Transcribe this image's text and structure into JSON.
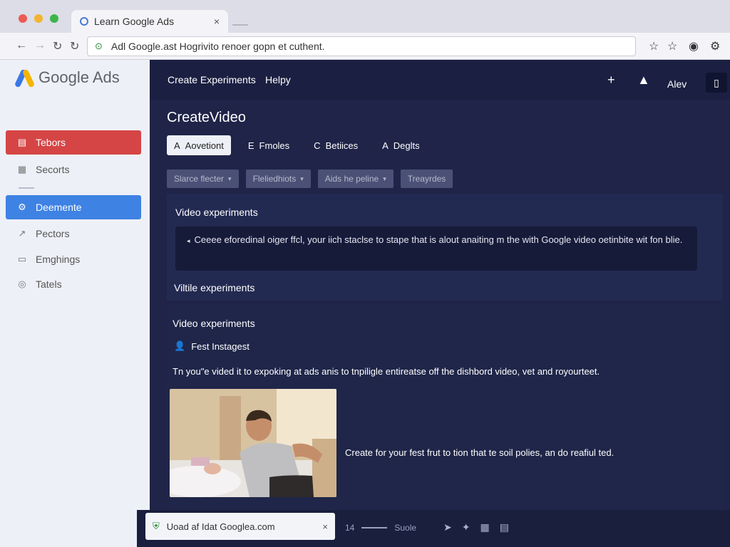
{
  "browser": {
    "tab_title": "Learn Google Ads",
    "tab_close": "×",
    "address_text": "Adl Google.ast Hogrivito renoer gopn et cuthent.",
    "lock_icon": "lock-icon"
  },
  "sidebar": {
    "logo_text": "Google Ads",
    "items": [
      {
        "label": "Tebors",
        "icon": "calendar-icon"
      },
      {
        "label": "Secorts",
        "icon": "grid-icon"
      },
      {
        "label": "Deemente",
        "icon": "gear-icon"
      },
      {
        "label": "Pectors",
        "icon": "arrow-icon"
      },
      {
        "label": "Emghings",
        "icon": "document-icon"
      },
      {
        "label": "Tatels",
        "icon": "target-icon"
      }
    ]
  },
  "topnav": {
    "link1": "Create Experiments",
    "link2": "Helpy",
    "account": "Alev"
  },
  "main": {
    "page_title": "CreateVideo",
    "tabs": [
      {
        "glyph": "A",
        "label": "Aovetiont"
      },
      {
        "glyph": "E",
        "label": "Fmoles"
      },
      {
        "glyph": "C",
        "label": "Betiices"
      },
      {
        "glyph": "A",
        "label": "Deglts"
      }
    ],
    "filters": [
      "Slarce flecter",
      "Fleliedhiots",
      "Aids he peline",
      "Treayrdes"
    ]
  },
  "card1": {
    "heading": "Video experiments",
    "info_text": "Ceeee eforedinal oiger ffcl, your iich staclse to stape that is alout anaiting m the with Google video oetinbite wit fon blie.",
    "subheading": "Viltile experiments"
  },
  "card2": {
    "heading": "Video experiments",
    "feature": "Fest Instagest",
    "description": "Tn you\"e vided it to expoking at ads anis to tnpiligle entireatse off the dishbord video, vet and royourteet.",
    "caption": "Create for your fest frut to tion that te soil polies, an do reafiul ted."
  },
  "downloads": {
    "item": "Uoad af Idat Googlea.com",
    "close": "×",
    "count": "14",
    "status": "Suole"
  },
  "colors": {
    "sidebar_active_red": "#d64545",
    "sidebar_active_blue": "#3e82e4",
    "app_background": "#1f2448"
  }
}
